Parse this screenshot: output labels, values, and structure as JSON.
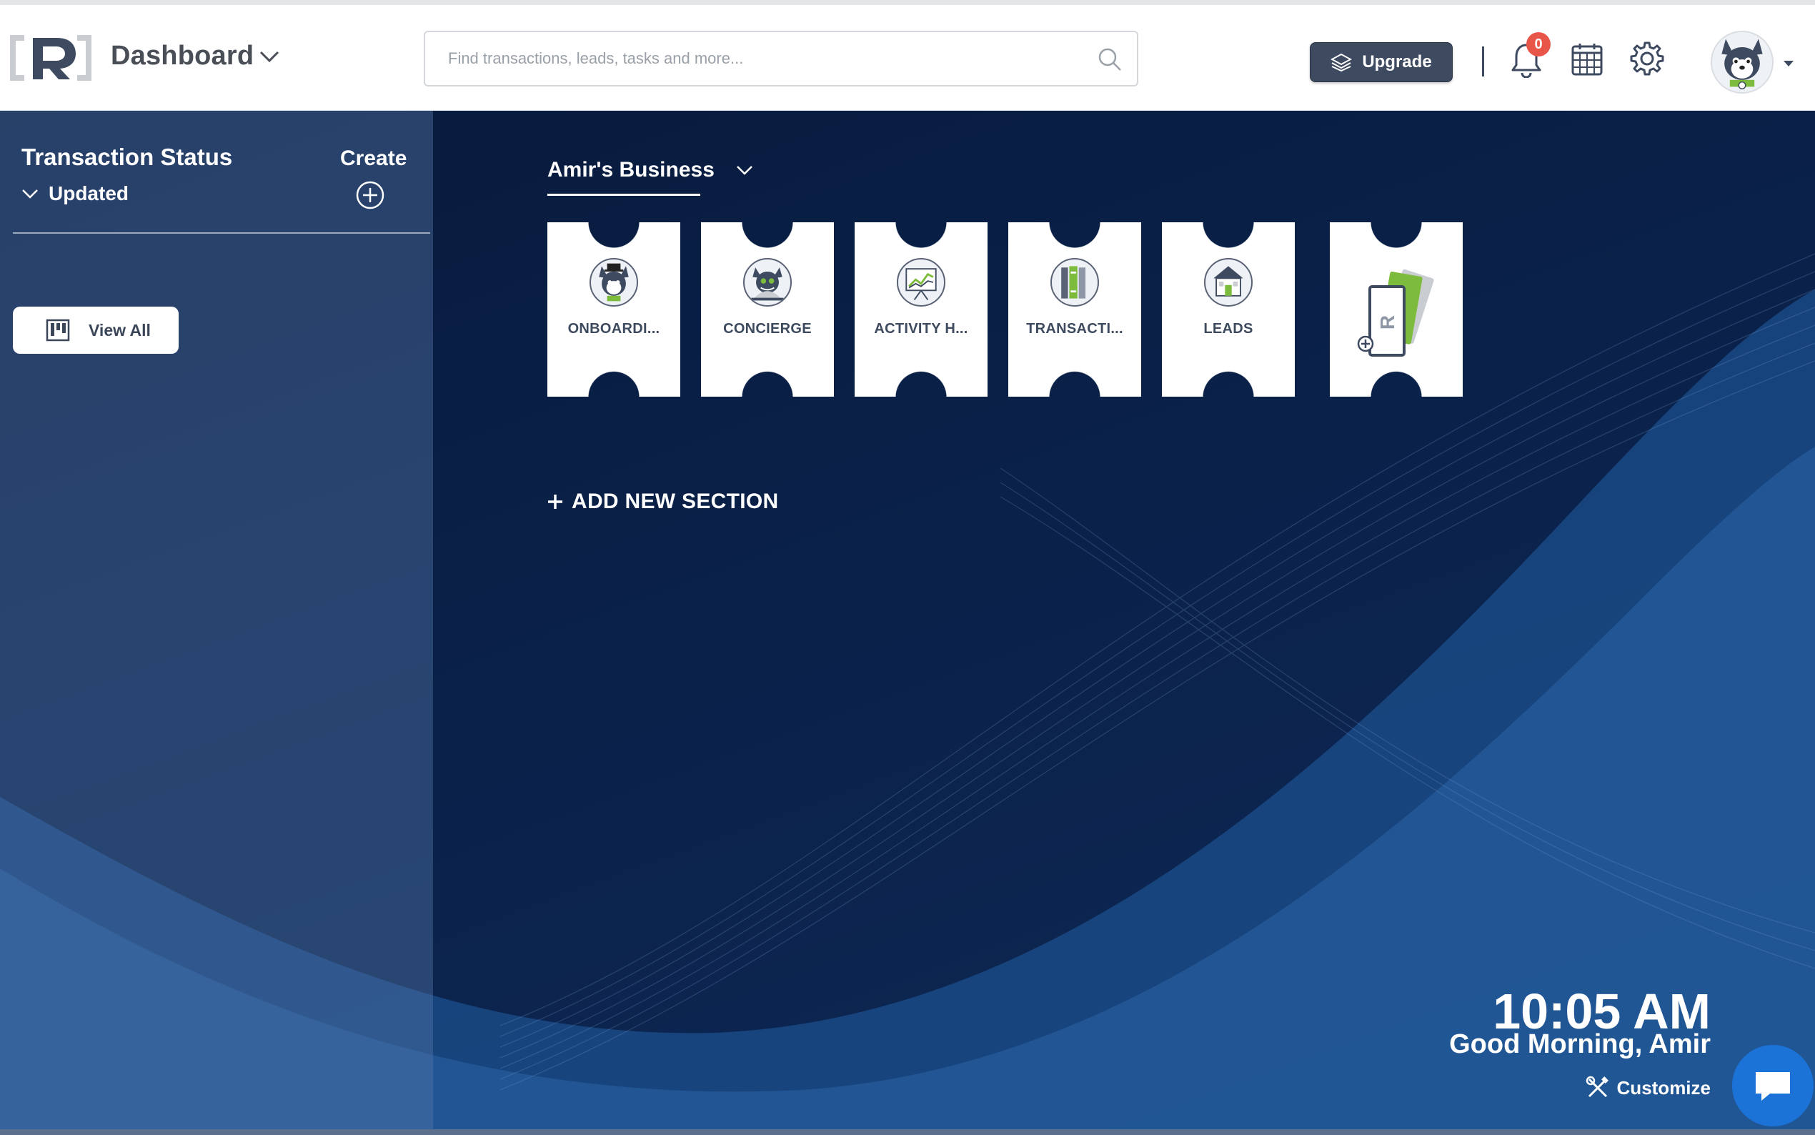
{
  "header": {
    "app_title": "Dashboard",
    "search": {
      "placeholder": "Find transactions, leads, tasks and more..."
    },
    "upgrade_label": "Upgrade",
    "notifications_count": "0"
  },
  "sidebar": {
    "title": "Transaction Status",
    "filter_label": "Updated",
    "create_label": "Create",
    "view_all_label": "View All"
  },
  "main": {
    "section_tab": "Amir's Business",
    "tiles": [
      {
        "label": "ONBOARDI...",
        "icon": "mascot-icon"
      },
      {
        "label": "CONCIERGE",
        "icon": "concierge-icon"
      },
      {
        "label": "ACTIVITY H...",
        "icon": "activity-chart-icon"
      },
      {
        "label": "TRANSACTI...",
        "icon": "binders-icon"
      },
      {
        "label": "LEADS",
        "icon": "house-icon"
      },
      {
        "label": "",
        "icon": "add-card-icon"
      }
    ],
    "add_section_label": "ADD NEW SECTION"
  },
  "footer": {
    "time": "10:05 AM",
    "greeting": "Good Morning, Amir",
    "customize_label": "Customize"
  },
  "colors": {
    "accent_dark": "#3d4a60",
    "background_navy": "#0b1d3f",
    "badge_red": "#e8564a",
    "chat_blue": "#1b73d8",
    "tile_green": "#7dbb3c"
  }
}
